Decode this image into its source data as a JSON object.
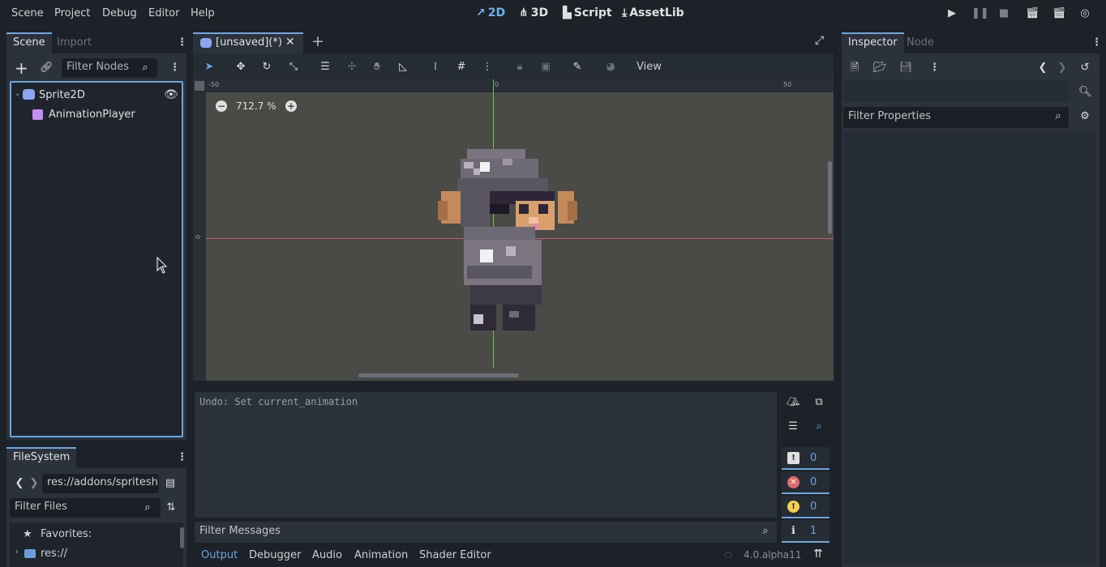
{
  "menu": [
    "Scene",
    "Project",
    "Debug",
    "Editor",
    "Help"
  ],
  "modes": [
    {
      "icon": "↗",
      "label": "2D",
      "active": true
    },
    {
      "icon": "⋔",
      "label": "3D",
      "active": false
    },
    {
      "icon": "▙",
      "label": "Script",
      "active": false
    },
    {
      "icon": "⤓",
      "label": "AssetLib",
      "active": false
    }
  ],
  "scene_dock": {
    "tab_active": "Scene",
    "tab_inactive": "Import",
    "filter_placeholder": "Filter Nodes",
    "tree": [
      {
        "label": "Sprite2D"
      },
      {
        "label": "AnimationPlayer"
      }
    ]
  },
  "filesystem": {
    "tab": "FileSystem",
    "path": "res://addons/spritesh",
    "filter_placeholder": "Filter Files",
    "items": [
      {
        "label": "Favorites:"
      },
      {
        "label": "res://"
      }
    ]
  },
  "editor": {
    "scene_tab": "[unsaved](*)",
    "toolbar_view": "View",
    "zoom": "712.7 %",
    "ruler": {
      "h": [
        "-50",
        "0",
        "50"
      ],
      "v": [
        "0"
      ]
    }
  },
  "output": {
    "log": "Undo: Set current_animation",
    "filter_placeholder": "Filter Messages",
    "counters": {
      "errors_total": "0",
      "errors": "0",
      "warnings": "0",
      "info": "1"
    }
  },
  "bottom_tabs": [
    "Output",
    "Debugger",
    "Audio",
    "Animation",
    "Shader Editor"
  ],
  "version": "4.0.alpha11",
  "inspector": {
    "tab_active": "Inspector",
    "tab_inactive": "Node",
    "filter_placeholder": "Filter Properties"
  },
  "colors": {
    "accent": "#6aa7e0",
    "bg": "#1d2229",
    "panel": "#21262e",
    "viewport": "#4a4a46"
  }
}
